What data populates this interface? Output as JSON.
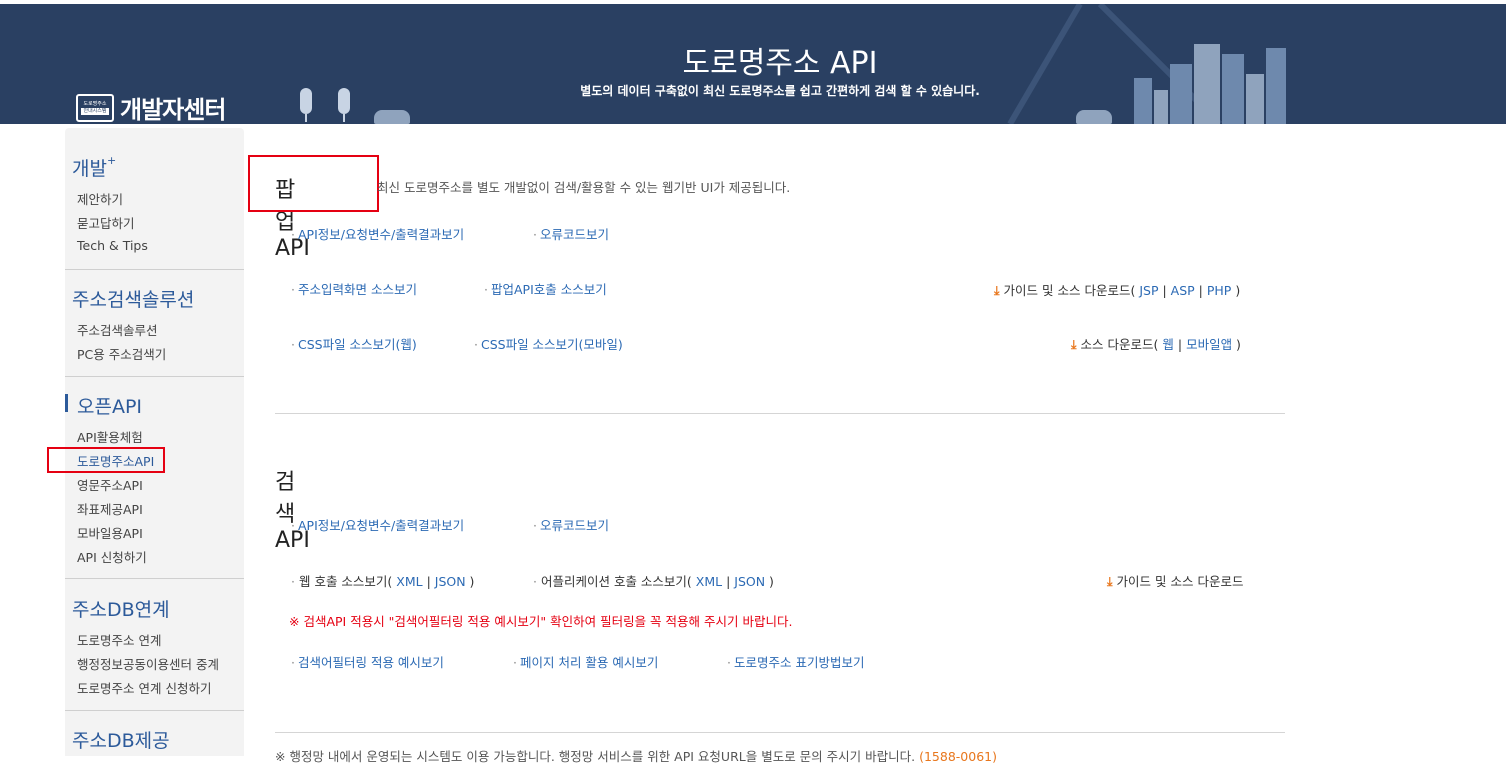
{
  "header": {
    "logo_badge_top": "도로명주소",
    "logo_badge_bottom": "안내시스템",
    "logo_text": "개발자센터",
    "title": "도로명주소 API",
    "subtitle": "별도의 데이터 구축없이 최신 도로명주소를 쉽고 간편하게 검색 할 수 있습니다."
  },
  "sidebar": {
    "sections": [
      {
        "title": "개발",
        "plus": "+",
        "items": [
          "제안하기",
          "묻고답하기",
          "Tech & Tips"
        ]
      },
      {
        "title": "주소검색솔루션",
        "items": [
          "주소검색솔루션",
          "PC용 주소검색기"
        ]
      },
      {
        "title": "오픈API",
        "items": [
          "API활용체험",
          "도로명주소API",
          "영문주소API",
          "좌표제공API",
          "모바일용API",
          "API 신청하기"
        ]
      },
      {
        "title": "주소DB연계",
        "items": [
          "도로명주소 연계",
          "행정정보공동이용센터 중계",
          "도로명주소 연계 신청하기"
        ]
      },
      {
        "title": "주소DB제공"
      }
    ]
  },
  "popup": {
    "title": "팝업 API",
    "description": "최신 도로명주소를 별도 개발없이 검색/활용할 수 있는 웹기반 UI가 제공됩니다.",
    "link1": "API정보/요청변수/출력결과보기",
    "link2": "오류코드보기",
    "link3": "주소입력화면 소스보기",
    "link4": "팝업API호출 소스보기",
    "link5": "CSS파일 소스보기(웹)",
    "link6": "CSS파일 소스보기(모바일)",
    "dl1_label": "가이드 및 소스 다운로드(",
    "dl1_jsp": "JSP",
    "dl1_asp": "ASP",
    "dl1_php": "PHP",
    "dl2_label": "소스 다운로드(",
    "dl2_web": "웹",
    "dl2_mobile": "모바일앱"
  },
  "search": {
    "title": "검색 API",
    "link1": "API정보/요청변수/출력결과보기",
    "link2": "오류코드보기",
    "web_call": "웹 호출 소스보기(",
    "app_call": "어플리케이션 호출 소스보기(",
    "xml": "XML",
    "json": "JSON",
    "download": "가이드 및 소스 다운로드",
    "warning": "※ 검색API 적용시 \"검색어필터링 적용 예시보기\" 확인하여 필터링을 꼭 적용해 주시기 바랍니다.",
    "link3": "검색어필터링 적용 예시보기",
    "link4": "페이지 처리 활용 예시보기",
    "link5": "도로명주소 표기방법보기"
  },
  "footer": {
    "note": "※ 행정망 내에서 운영되는 시스템도 이용 가능합니다. 행정망 서비스를 위한 API 요청URL을 별도로 문의 주시기 바랍니다.",
    "phone": "(1588-0061)"
  },
  "colors": {
    "header_bg": "#2a4062",
    "link": "#2c6ab4",
    "highlight": "#e50012",
    "download_icon": "#e8771e"
  }
}
